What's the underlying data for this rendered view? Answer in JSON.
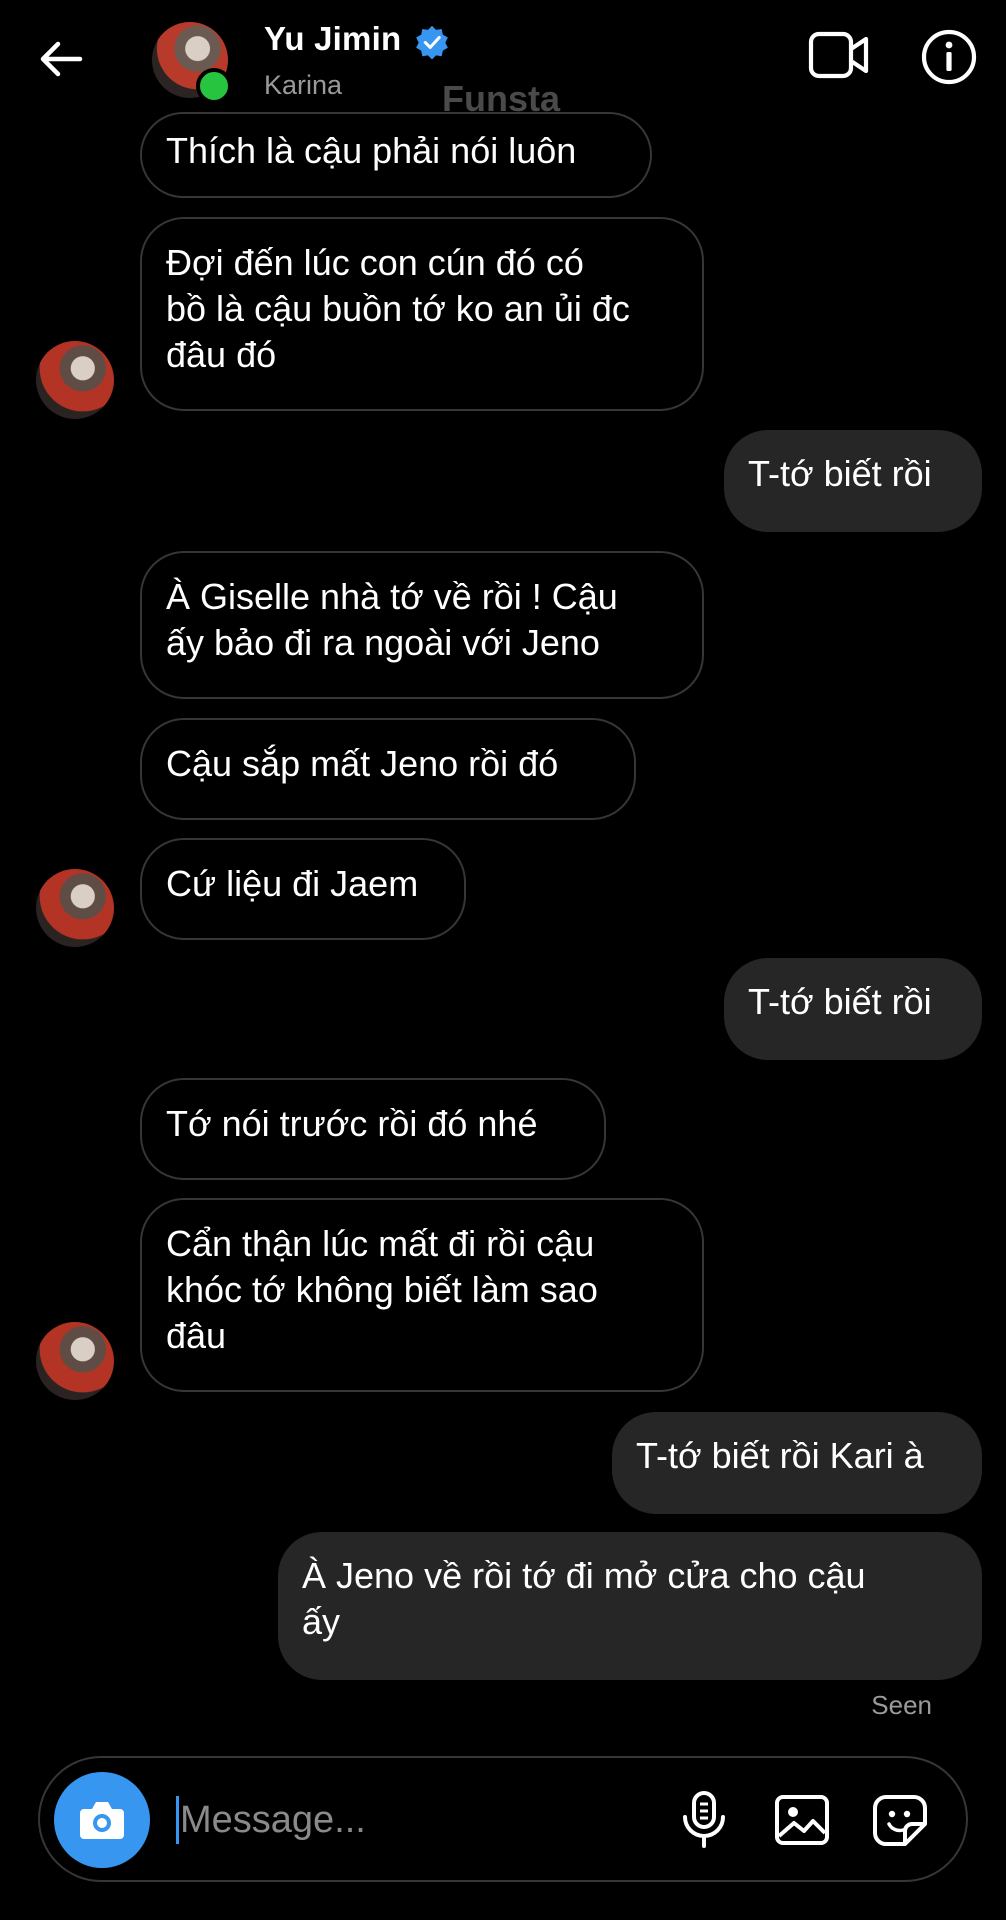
{
  "header": {
    "name": "Yu Jimin",
    "subtitle": "Karina",
    "watermark": "Funsta",
    "icons": [
      "back-arrow-icon",
      "verified-icon",
      "video-call-icon",
      "info-icon"
    ],
    "colors": {
      "verified": "#3797f0",
      "online": "#27c43f"
    }
  },
  "messages": [
    {
      "from": "them",
      "text": "Thích là cậu phải nói luôn"
    },
    {
      "from": "them",
      "text": "Đợi đến lúc con cún đó có\nbồ là cậu buồn tớ ko an ủi đc\nđâu đó"
    },
    {
      "from": "me",
      "text": "T-tớ biết rồi"
    },
    {
      "from": "them",
      "text": "À Giselle nhà tớ về rồi ! Cậu\nấy bảo đi ra ngoài với Jeno"
    },
    {
      "from": "them",
      "text": "Cậu sắp mất Jeno rồi đó"
    },
    {
      "from": "them",
      "text": "Cứ liệu đi Jaem"
    },
    {
      "from": "me",
      "text": "T-tớ biết rồi"
    },
    {
      "from": "them",
      "text": "Tớ nói trước rồi đó nhé"
    },
    {
      "from": "them",
      "text": "Cẩn thận lúc mất đi rồi cậu\nkhóc tớ không biết làm sao\nđâu"
    },
    {
      "from": "me",
      "text": "T-tớ biết rồi Kari à"
    },
    {
      "from": "me",
      "text": "À Jeno về rồi tớ đi mở cửa cho cậu\nấy"
    }
  ],
  "status": {
    "seen": "Seen"
  },
  "composer": {
    "placeholder": "Message...",
    "value": "",
    "icons": [
      "camera-icon",
      "microphone-icon",
      "gallery-icon",
      "sticker-icon"
    ]
  }
}
